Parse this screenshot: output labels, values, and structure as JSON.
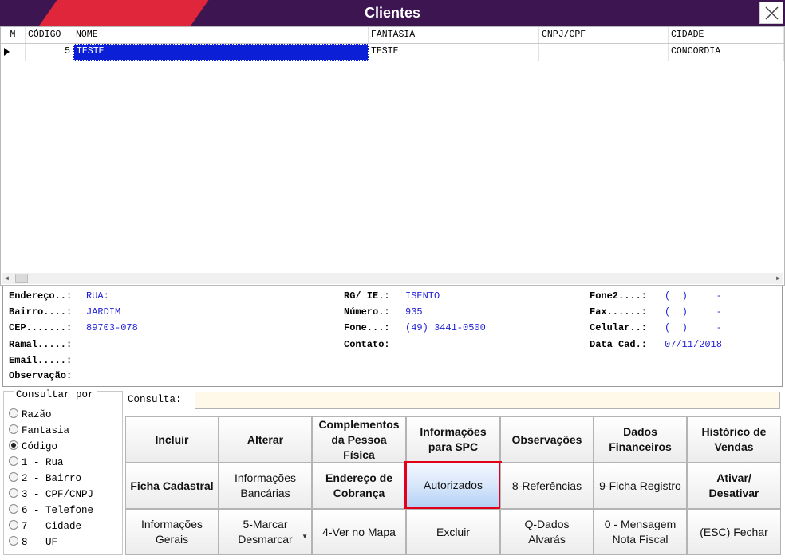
{
  "window": {
    "title": "Clientes"
  },
  "grid": {
    "headers": [
      "M",
      "CÓDIGO",
      "NOME",
      "FANTASIA",
      "CNPJ/CPF",
      "CIDADE"
    ],
    "rows": [
      {
        "codigo": "5",
        "nome": "TESTE",
        "fantasia": "TESTE",
        "cnpj": "",
        "cidade": "CONCORDIA"
      }
    ]
  },
  "details": {
    "endereco": {
      "label": "Endereço..:",
      "value": "RUA:"
    },
    "bairro": {
      "label": "Bairro....:",
      "value": "JARDIM"
    },
    "cep": {
      "label": "CEP.......:",
      "value": "89703-078"
    },
    "ramal": {
      "label": "Ramal.....:",
      "value": ""
    },
    "email": {
      "label": "Email.....:",
      "value": ""
    },
    "observacao": {
      "label": "Observação:",
      "value": ""
    },
    "rg_ie": {
      "label": "RG/ IE.:",
      "value": "ISENTO"
    },
    "numero": {
      "label": "Número.:",
      "value": "935"
    },
    "fone": {
      "label": "Fone...:",
      "value": "(49) 3441-0500"
    },
    "contato": {
      "label": "Contato:",
      "value": ""
    },
    "fone2": {
      "label": "Fone2....:",
      "value": "(  )     -"
    },
    "fax": {
      "label": "Fax......:",
      "value": "(  )     -"
    },
    "celular": {
      "label": "Celular..:",
      "value": "(  )     -"
    },
    "data_cad": {
      "label": "Data Cad.:",
      "value": "07/11/2018"
    }
  },
  "search": {
    "legend": "Consultar por",
    "options": [
      "Razão",
      "Fantasia",
      "Código",
      "1 - Rua",
      "2 - Bairro",
      "3 - CPF/CNPJ",
      "6 - Telefone",
      "7 - Cidade",
      "8 - UF"
    ],
    "selected": "Código",
    "consulta_label": "Consulta:",
    "consulta_value": ""
  },
  "buttons": {
    "incluir": "Incluir",
    "alterar": "Alterar",
    "complementos": "Complementos\nda Pessoa\nFísica",
    "info_spc": "Informações\npara SPC",
    "observacoes": "Observações",
    "dados_financeiros": "Dados\nFinanceiros",
    "historico_vendas": "Histórico de\nVendas",
    "ficha_cadastral": "Ficha Cadastral",
    "info_bancarias": "Informações\nBancárias",
    "endereco_cobranca": "Endereço de\nCobrança",
    "autorizados": "Autorizados",
    "referencias": "8-Referências",
    "ficha_registro": "9-Ficha Registro",
    "ativar_desativar": "Ativar/\nDesativar",
    "info_gerais": "Informações\nGerais",
    "marcar_desmarcar": "5-Marcar\nDesmarcar",
    "ver_mapa": "4-Ver no Mapa",
    "excluir": "Excluir",
    "dados_alvaras": "Q-Dados\nAlvarás",
    "mensagem_nf": "0 - Mensagem\nNota Fiscal",
    "fechar": "(ESC) Fechar"
  },
  "colors": {
    "title_bg": "#3c1551",
    "title_accent": "#e0263a",
    "selection": "#0a1fd6",
    "value_text": "#1e1ed6",
    "highlight_border": "#e3001b"
  }
}
